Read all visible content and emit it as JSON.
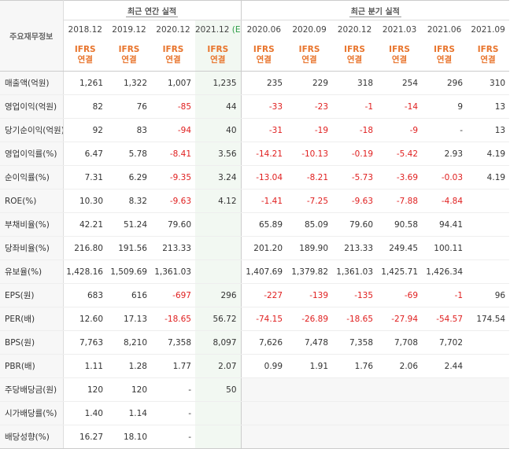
{
  "header": {
    "corner_label": "주요재무정보",
    "annual_group": "최근 연간 실적",
    "quarter_group": "최근 분기 실적",
    "periods": [
      "2018.12",
      "2019.12",
      "2020.12",
      "2021.12",
      "2020.06",
      "2020.09",
      "2020.12",
      "2021.03",
      "2021.06",
      "2021.09"
    ],
    "estimate_suffix": "(E)",
    "ifrs_top": "IFRS",
    "ifrs_bottom": "연결"
  },
  "rows": [
    {
      "label": "매출액(억원)",
      "values": [
        "1,261",
        "1,322",
        "1,007",
        "1,235",
        "235",
        "229",
        "318",
        "254",
        "296",
        "310"
      ]
    },
    {
      "label": "영업이익(억원)",
      "values": [
        "82",
        "76",
        "-85",
        "44",
        "-33",
        "-23",
        "-1",
        "-14",
        "9",
        "13"
      ]
    },
    {
      "label": "당기순이익(억원)",
      "values": [
        "92",
        "83",
        "-94",
        "40",
        "-31",
        "-19",
        "-18",
        "-9",
        "-",
        "13"
      ]
    },
    {
      "label": "영업이익률(%)",
      "values": [
        "6.47",
        "5.78",
        "-8.41",
        "3.56",
        "-14.21",
        "-10.13",
        "-0.19",
        "-5.42",
        "2.93",
        "4.19"
      ]
    },
    {
      "label": "순이익률(%)",
      "values": [
        "7.31",
        "6.29",
        "-9.35",
        "3.24",
        "-13.04",
        "-8.21",
        "-5.73",
        "-3.69",
        "-0.03",
        "4.19"
      ]
    },
    {
      "label": "ROE(%)",
      "values": [
        "10.30",
        "8.32",
        "-9.63",
        "4.12",
        "-1.41",
        "-7.25",
        "-9.63",
        "-7.88",
        "-4.84",
        ""
      ]
    },
    {
      "label": "부채비율(%)",
      "values": [
        "42.21",
        "51.24",
        "79.60",
        "",
        "65.89",
        "85.09",
        "79.60",
        "90.58",
        "94.41",
        ""
      ]
    },
    {
      "label": "당좌비율(%)",
      "values": [
        "216.80",
        "191.56",
        "213.33",
        "",
        "201.20",
        "189.90",
        "213.33",
        "249.45",
        "100.11",
        ""
      ]
    },
    {
      "label": "유보율(%)",
      "values": [
        "1,428.16",
        "1,509.69",
        "1,361.03",
        "",
        "1,407.69",
        "1,379.82",
        "1,361.03",
        "1,425.71",
        "1,426.34",
        ""
      ]
    },
    {
      "label": "EPS(원)",
      "values": [
        "683",
        "616",
        "-697",
        "296",
        "-227",
        "-139",
        "-135",
        "-69",
        "-1",
        "96"
      ]
    },
    {
      "label": "PER(배)",
      "values": [
        "12.60",
        "17.13",
        "-18.65",
        "56.72",
        "-74.15",
        "-26.89",
        "-18.65",
        "-27.94",
        "-54.57",
        "174.54"
      ]
    },
    {
      "label": "BPS(원)",
      "values": [
        "7,763",
        "8,210",
        "7,358",
        "8,097",
        "7,626",
        "7,478",
        "7,358",
        "7,708",
        "7,702",
        ""
      ]
    },
    {
      "label": "PBR(배)",
      "values": [
        "1.11",
        "1.28",
        "1.77",
        "2.07",
        "0.99",
        "1.91",
        "1.76",
        "2.06",
        "2.44",
        ""
      ]
    },
    {
      "label": "주당배당금(원)",
      "values": [
        "120",
        "120",
        "-",
        "50",
        "",
        "",
        "",
        "",
        "",
        ""
      ]
    },
    {
      "label": "시가배당률(%)",
      "values": [
        "1.40",
        "1.14",
        "-",
        "",
        "",
        "",
        "",
        "",
        "",
        ""
      ]
    },
    {
      "label": "배당성향(%)",
      "values": [
        "16.27",
        "18.10",
        "-",
        "",
        "",
        "",
        "",
        "",
        "",
        ""
      ]
    }
  ]
}
